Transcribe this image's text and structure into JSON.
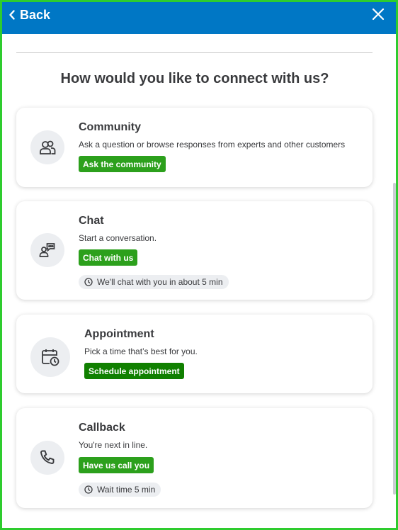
{
  "header": {
    "back_label": "Back"
  },
  "page_title": "How would you like to connect with us?",
  "cards": [
    {
      "icon": "community-people-icon",
      "title": "Community",
      "description": "Ask a question or browse responses from experts and other customers",
      "button_label": "Ask the community"
    },
    {
      "icon": "chat-bubble-icon",
      "title": "Chat",
      "description": "Start a conversation.",
      "button_label": "Chat with us",
      "wait_text": "We'll chat with you in about 5 min"
    },
    {
      "icon": "calendar-clock-icon",
      "title": "Appointment",
      "description": "Pick a time that’s best for you.",
      "button_label": "Schedule appointment"
    },
    {
      "icon": "phone-icon",
      "title": "Callback",
      "description": "You're next in line.",
      "button_label": "Have us call you",
      "wait_text": "Wait time 5 min"
    }
  ],
  "colors": {
    "header_bg": "#0077c5",
    "button_green": "#2ca01c",
    "button_dark_green": "#108000",
    "frame_border": "#2ecc2e"
  }
}
